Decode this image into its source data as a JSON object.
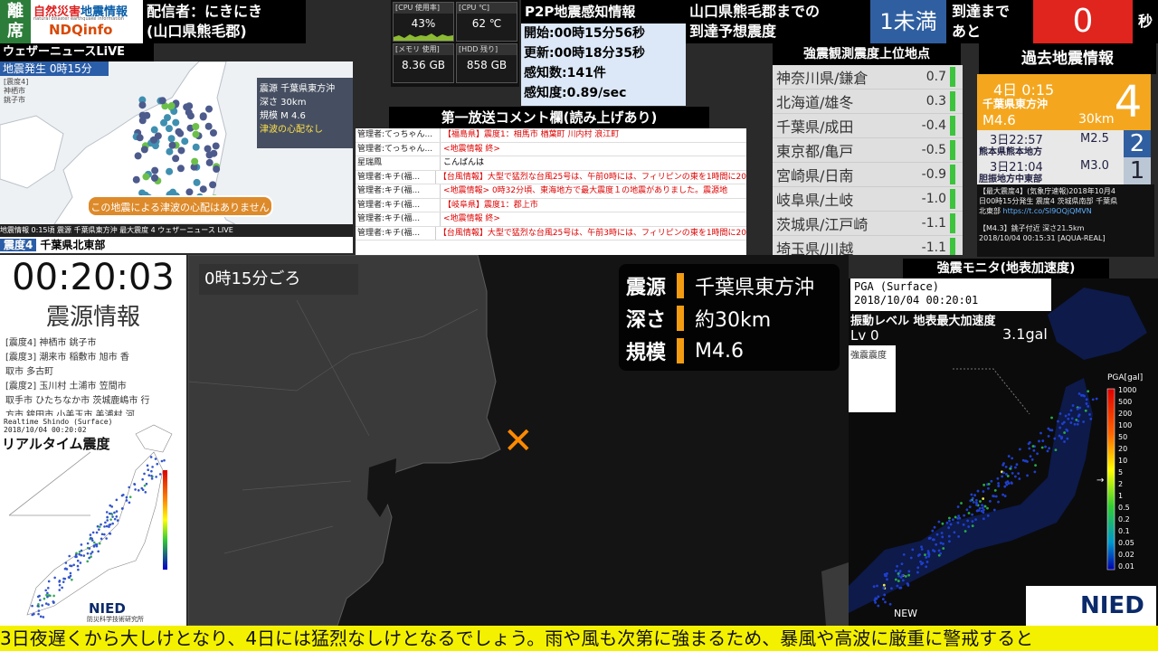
{
  "header": {
    "away": "離席",
    "logo_line1a": "自然災害",
    "logo_line1b": "地震情報",
    "logo_line2": "natural disaster  earthquake information",
    "logo_line3": "NDQinfo",
    "distributor_line1": "配信者：にきにき",
    "distributor_line2": "(山口県熊毛郡)",
    "predict_line1": "山口県熊毛郡までの",
    "predict_line2": "到達予想震度",
    "predict_level": "1未満",
    "arrival_line1": "到達まで",
    "arrival_line2": "あと",
    "countdown": "0",
    "seconds_unit": "秒"
  },
  "system": {
    "cpu_use_label": "[CPU 使用率]",
    "cpu_use": "43%",
    "cpu_temp_label": "[CPU ℃]",
    "cpu_temp": "62 ℃",
    "mem_label": "[メモリ 使用]",
    "mem": "8.36 GB",
    "hdd_label": "[HDD 残り]",
    "hdd": "858 GB"
  },
  "p2p": {
    "title": "P2P地震感知情報",
    "start": "開始:00時15分56秒",
    "update": "更新:00時18分35秒",
    "count": "感知数:141件",
    "rate": "感知度:0.89/sec"
  },
  "weathernews": {
    "title": "ウェザーニュースLiVE",
    "occurrence": "地震発生 0時15分",
    "labels": [
      "[震度4]",
      "神栖市",
      "銚子市"
    ],
    "epicenter_label": "震源  千葉県東方沖",
    "depth_label": "深さ  30km",
    "scale_label": "規模  M 4.6",
    "tsunami_warn": "津波の心配なし",
    "tsunami_banner": "この地震による津波の心配はありません",
    "bottom_bar": "地震情報      0:15頃     震源  千葉県東方沖     最大震度  4    ウェザーニュース LIVE",
    "bottom_shindo": "震度4",
    "bottom_place": "千葉県北東部"
  },
  "comments": {
    "title": "第一放送コメント欄(読み上げあり)",
    "rows": [
      {
        "name": "管理者:てっちゃん...",
        "msg": "【福島県】震度1：相馬市 楢葉町 川内村 浪江町",
        "black": false
      },
      {
        "name": "管理者:てっちゃん...",
        "msg": "<地震情報 終>",
        "black": false
      },
      {
        "name": "星瑞鳳",
        "msg": "こんばんは",
        "black": true
      },
      {
        "name": "管理者:キチ(福...",
        "msg": "【台風情報】大型で猛烈な台風25号は、午前0時には、フィリピンの東を1時間に20",
        "black": false
      },
      {
        "name": "管理者:キチ(福...",
        "msg": "<地震情報> 0時32分頃、東海地方で最大震度１の地震がありました。震源地",
        "black": false
      },
      {
        "name": "管理者:キチ(福...",
        "msg": "【岐阜県】震度1：郡上市",
        "black": false
      },
      {
        "name": "管理者:キチ(福...",
        "msg": "<地震情報 終>",
        "black": false
      },
      {
        "name": "管理者:キチ(福...",
        "msg": "【台風情報】大型で猛烈な台風25号は、午前3時には、フィリピンの東を1時間に20",
        "black": false
      }
    ]
  },
  "strong_obs": {
    "title": "強震観測震度上位地点",
    "rows": [
      {
        "place": "神奈川県/鎌倉",
        "value": "0.7"
      },
      {
        "place": "北海道/雄冬",
        "value": "0.3"
      },
      {
        "place": "千葉県/成田",
        "value": "-0.4"
      },
      {
        "place": "東京都/亀戸",
        "value": "-0.5"
      },
      {
        "place": "宮崎県/日南",
        "value": "-0.9"
      },
      {
        "place": "岐阜県/土岐",
        "value": "-1.0"
      },
      {
        "place": "茨城県/江戸崎",
        "value": "-1.1"
      },
      {
        "place": "埼玉県/川越",
        "value": "-1.1"
      }
    ]
  },
  "past": {
    "title": "過去地震情報",
    "latest": {
      "date": "4日  0:15",
      "place": "千葉県東方沖",
      "mag": "M4.6",
      "depth": "30km",
      "shindo": "4"
    },
    "items": [
      {
        "date": "3日22:57",
        "place": "熊本県熊本地方",
        "mag": "M2.5",
        "shindo": "2"
      },
      {
        "date": "3日21:04",
        "place": "胆振地方中東部",
        "mag": "M3.0",
        "shindo": "1"
      }
    ]
  },
  "tweet": {
    "line1": "【最大震度4】(気象庁速報)2018年10月4",
    "line2": "日00時15分発生 震度4 茨城県南部 千葉県",
    "line3": "北東部",
    "link": "https://t.co/Sl9OQjQMVN",
    "line4": "【M4.3】銚子付近 深さ21.5km",
    "line5": "2018/10/04 00:15:31 [AQUA-REAL]"
  },
  "clock": {
    "time": "00:20:03",
    "heading": "震源情報"
  },
  "epicenter_info": {
    "lines": [
      "[震度4] 神栖市 銚子市",
      "[震度3] 潮来市 稲敷市 旭市 香",
      "取市 多古町",
      "[震度2] 玉川村 土浦市 笠間市",
      "取手市 ひたちなか市 茨城鹿嶋市 行",
      "方市 鉾田市 小美玉市 美浦村 河"
    ]
  },
  "realtime": {
    "caption1": "Realtime Shindo (Surface)",
    "caption2": "2018/10/04 00:20:02",
    "title": "リアルタイム震度",
    "logo": "NIED",
    "logo_sub": "防災科学技術研究所"
  },
  "main_map": {
    "time": "0時15分ごろ",
    "epicenter_key": "震源",
    "epicenter": "千葉県東方沖",
    "depth_key": "深さ",
    "depth": "約30km",
    "scale_key": "規模",
    "scale": "M4.6"
  },
  "monitor": {
    "title": "強震モニタ(地表加速度)",
    "pga1": "PGA (Surface)",
    "pga2": "2018/10/04 00:20:01",
    "vib_label": "振動レベル  地表最大加速度",
    "lv": "Lv 0",
    "gal": "3.1gal",
    "box": "強震震度",
    "scale_title": "PGA[gal]",
    "scale_values": [
      "1000",
      "500",
      "200",
      "100",
      "50",
      "20",
      "10",
      "5",
      "2",
      "1",
      "0.5",
      "0.2",
      "0.1",
      "0.05",
      "0.02",
      "0.01"
    ],
    "new": "NEW",
    "logo": "NIED"
  },
  "ticker": "3日夜遅くから大しけとなり、4日には猛烈なしけとなるでしょう。雨や風も次第に強まるため、暴風や高波に厳重に警戒すると",
  "colors": {
    "accent_green": "#2d7d3a",
    "count_red": "#e0241e",
    "level_blue": "#2f5fa0",
    "past_orange": "#f4a71e",
    "ticker_yellow": "#f4f100"
  }
}
